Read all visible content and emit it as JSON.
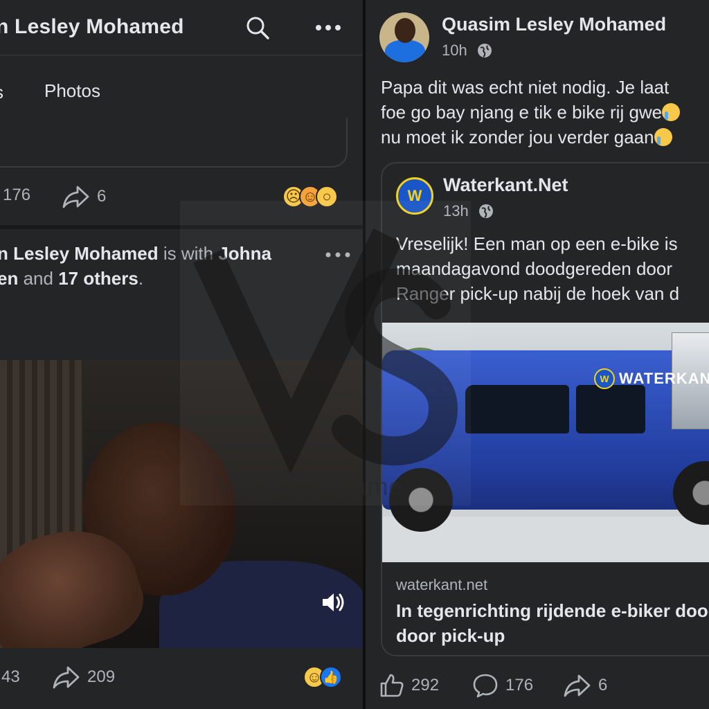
{
  "left": {
    "header": {
      "title": "n Lesley Mohamed"
    },
    "tabs": {
      "stub": "s",
      "photos": "Photos"
    },
    "post1": {
      "comments": "176",
      "shares": "6"
    },
    "post2": {
      "author": "n Lesley Mohamed",
      "with": "is with",
      "tagged": "Johna",
      "line2_name": "en",
      "and": "and",
      "others": "17 others",
      "period": ".",
      "likes": "43",
      "shares": "209"
    }
  },
  "watermark": {
    "text": "Viraal Suriname"
  },
  "right": {
    "author": "Quasim Lesley Mohamed",
    "time": "10h",
    "text_line1": "Papa dit was echt niet nodig. Je laat",
    "text_line2": "foe go bay njang e tik e bike rij gwe",
    "text_line3": "nu moet ik zonder jou verder gaan",
    "shared": {
      "page": "Waterkant.Net",
      "time": "13h",
      "text": "Vreselijk! Een man op een e-bike is\nmaandagavond doodgereden door\nRanger pick-up nabij de hoek van d",
      "photo_watermark": "WATERKANT",
      "domain": "waterkant.net",
      "title": "In tegenrichting rijdende e-biker dood\ndoor pick-up"
    },
    "actions": {
      "likes": "292",
      "comments": "176",
      "shares": "6"
    }
  },
  "colors": {
    "bg": "#242526",
    "text": "#e4e6eb",
    "muted": "#b0b3b8",
    "accent": "#1877f2",
    "brand": "#1a56c8",
    "brand_ring": "#f3d21c"
  },
  "icons": [
    "search-icon",
    "more-icon",
    "share-icon",
    "globe-icon",
    "like-icon",
    "comment-icon",
    "speaker-icon"
  ]
}
